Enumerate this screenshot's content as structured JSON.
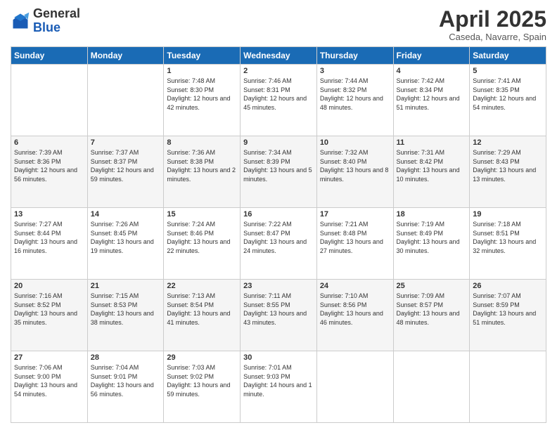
{
  "header": {
    "logo_general": "General",
    "logo_blue": "Blue",
    "title": "April 2025",
    "location": "Caseda, Navarre, Spain"
  },
  "days_of_week": [
    "Sunday",
    "Monday",
    "Tuesday",
    "Wednesday",
    "Thursday",
    "Friday",
    "Saturday"
  ],
  "weeks": [
    [
      {
        "day": "",
        "info": ""
      },
      {
        "day": "",
        "info": ""
      },
      {
        "day": "1",
        "info": "Sunrise: 7:48 AM\nSunset: 8:30 PM\nDaylight: 12 hours and 42 minutes."
      },
      {
        "day": "2",
        "info": "Sunrise: 7:46 AM\nSunset: 8:31 PM\nDaylight: 12 hours and 45 minutes."
      },
      {
        "day": "3",
        "info": "Sunrise: 7:44 AM\nSunset: 8:32 PM\nDaylight: 12 hours and 48 minutes."
      },
      {
        "day": "4",
        "info": "Sunrise: 7:42 AM\nSunset: 8:34 PM\nDaylight: 12 hours and 51 minutes."
      },
      {
        "day": "5",
        "info": "Sunrise: 7:41 AM\nSunset: 8:35 PM\nDaylight: 12 hours and 54 minutes."
      }
    ],
    [
      {
        "day": "6",
        "info": "Sunrise: 7:39 AM\nSunset: 8:36 PM\nDaylight: 12 hours and 56 minutes."
      },
      {
        "day": "7",
        "info": "Sunrise: 7:37 AM\nSunset: 8:37 PM\nDaylight: 12 hours and 59 minutes."
      },
      {
        "day": "8",
        "info": "Sunrise: 7:36 AM\nSunset: 8:38 PM\nDaylight: 13 hours and 2 minutes."
      },
      {
        "day": "9",
        "info": "Sunrise: 7:34 AM\nSunset: 8:39 PM\nDaylight: 13 hours and 5 minutes."
      },
      {
        "day": "10",
        "info": "Sunrise: 7:32 AM\nSunset: 8:40 PM\nDaylight: 13 hours and 8 minutes."
      },
      {
        "day": "11",
        "info": "Sunrise: 7:31 AM\nSunset: 8:42 PM\nDaylight: 13 hours and 10 minutes."
      },
      {
        "day": "12",
        "info": "Sunrise: 7:29 AM\nSunset: 8:43 PM\nDaylight: 13 hours and 13 minutes."
      }
    ],
    [
      {
        "day": "13",
        "info": "Sunrise: 7:27 AM\nSunset: 8:44 PM\nDaylight: 13 hours and 16 minutes."
      },
      {
        "day": "14",
        "info": "Sunrise: 7:26 AM\nSunset: 8:45 PM\nDaylight: 13 hours and 19 minutes."
      },
      {
        "day": "15",
        "info": "Sunrise: 7:24 AM\nSunset: 8:46 PM\nDaylight: 13 hours and 22 minutes."
      },
      {
        "day": "16",
        "info": "Sunrise: 7:22 AM\nSunset: 8:47 PM\nDaylight: 13 hours and 24 minutes."
      },
      {
        "day": "17",
        "info": "Sunrise: 7:21 AM\nSunset: 8:48 PM\nDaylight: 13 hours and 27 minutes."
      },
      {
        "day": "18",
        "info": "Sunrise: 7:19 AM\nSunset: 8:49 PM\nDaylight: 13 hours and 30 minutes."
      },
      {
        "day": "19",
        "info": "Sunrise: 7:18 AM\nSunset: 8:51 PM\nDaylight: 13 hours and 32 minutes."
      }
    ],
    [
      {
        "day": "20",
        "info": "Sunrise: 7:16 AM\nSunset: 8:52 PM\nDaylight: 13 hours and 35 minutes."
      },
      {
        "day": "21",
        "info": "Sunrise: 7:15 AM\nSunset: 8:53 PM\nDaylight: 13 hours and 38 minutes."
      },
      {
        "day": "22",
        "info": "Sunrise: 7:13 AM\nSunset: 8:54 PM\nDaylight: 13 hours and 41 minutes."
      },
      {
        "day": "23",
        "info": "Sunrise: 7:11 AM\nSunset: 8:55 PM\nDaylight: 13 hours and 43 minutes."
      },
      {
        "day": "24",
        "info": "Sunrise: 7:10 AM\nSunset: 8:56 PM\nDaylight: 13 hours and 46 minutes."
      },
      {
        "day": "25",
        "info": "Sunrise: 7:09 AM\nSunset: 8:57 PM\nDaylight: 13 hours and 48 minutes."
      },
      {
        "day": "26",
        "info": "Sunrise: 7:07 AM\nSunset: 8:59 PM\nDaylight: 13 hours and 51 minutes."
      }
    ],
    [
      {
        "day": "27",
        "info": "Sunrise: 7:06 AM\nSunset: 9:00 PM\nDaylight: 13 hours and 54 minutes."
      },
      {
        "day": "28",
        "info": "Sunrise: 7:04 AM\nSunset: 9:01 PM\nDaylight: 13 hours and 56 minutes."
      },
      {
        "day": "29",
        "info": "Sunrise: 7:03 AM\nSunset: 9:02 PM\nDaylight: 13 hours and 59 minutes."
      },
      {
        "day": "30",
        "info": "Sunrise: 7:01 AM\nSunset: 9:03 PM\nDaylight: 14 hours and 1 minute."
      },
      {
        "day": "",
        "info": ""
      },
      {
        "day": "",
        "info": ""
      },
      {
        "day": "",
        "info": ""
      }
    ]
  ]
}
